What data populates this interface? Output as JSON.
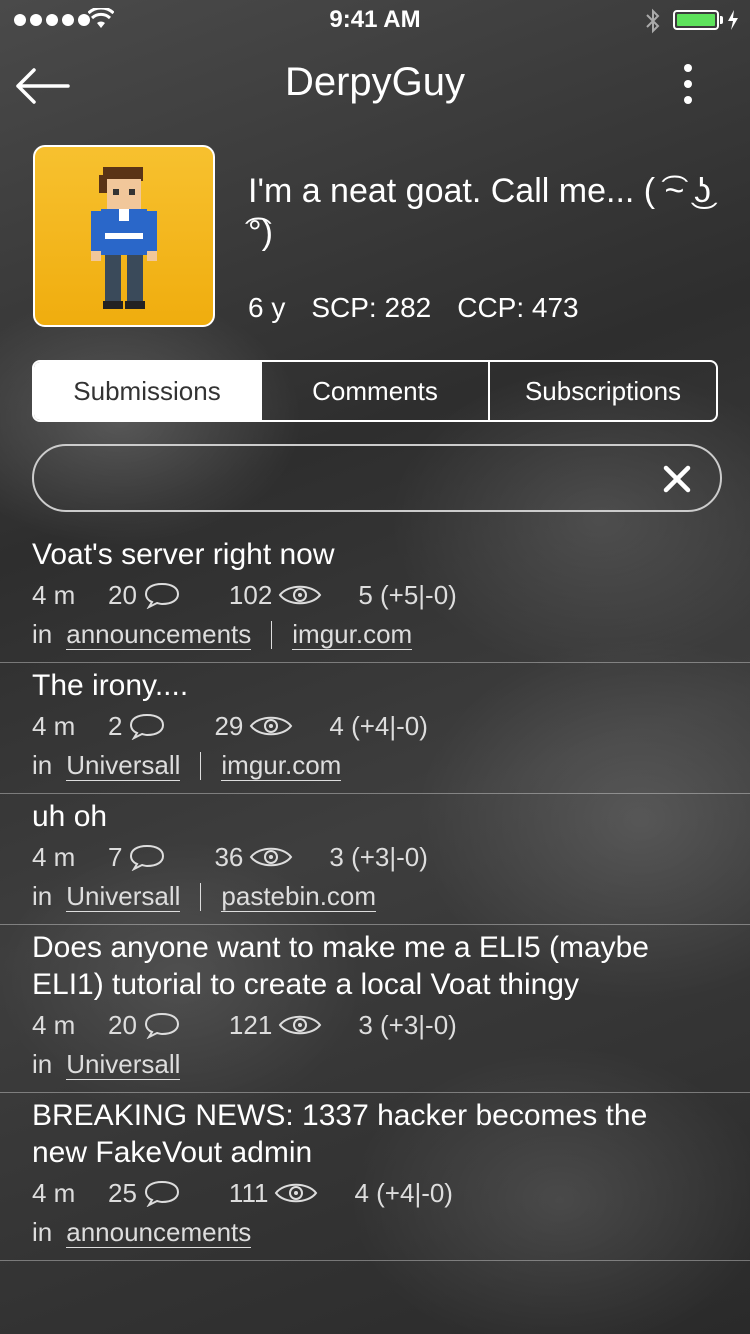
{
  "status": {
    "time": "9:41 AM"
  },
  "nav": {
    "title": "DerpyGuy"
  },
  "profile": {
    "bio": "I'm a neat goat. Call me... ( ͡~ ͜ʖ ͡°)",
    "age": "6 y",
    "scp": "SCP: 282",
    "ccp": "CCP: 473"
  },
  "tabs": [
    {
      "label": "Submissions",
      "active": true
    },
    {
      "label": "Comments",
      "active": false
    },
    {
      "label": "Subscriptions",
      "active": false
    }
  ],
  "search": {
    "value": ""
  },
  "prefix_in": "in",
  "posts": [
    {
      "title": "Voat's server right now",
      "age": "4 m",
      "comments": "20",
      "views": "102",
      "score": "5 (+5|-0)",
      "sub": "announcements",
      "domain": "imgur.com"
    },
    {
      "title": "The irony....",
      "age": "4 m",
      "comments": "2",
      "views": "29",
      "score": "4 (+4|-0)",
      "sub": "Universall",
      "domain": "imgur.com"
    },
    {
      "title": "uh oh",
      "age": "4 m",
      "comments": "7",
      "views": "36",
      "score": "3 (+3|-0)",
      "sub": "Universall",
      "domain": "pastebin.com"
    },
    {
      "title": "Does anyone want to make me a ELI5 (maybe ELI1) tutorial to create a local Voat thingy",
      "age": "4 m",
      "comments": "20",
      "views": "121",
      "score": "3 (+3|-0)",
      "sub": "Universall",
      "domain": ""
    },
    {
      "title": "BREAKING NEWS: 1337 hacker becomes the new FakeVout admin",
      "age": "4 m",
      "comments": "25",
      "views": "111",
      "score": "4 (+4|-0)",
      "sub": "announcements",
      "domain": ""
    }
  ],
  "colors": {
    "battery": "#5ee35c",
    "avatar_bg": "#f7c12f"
  }
}
